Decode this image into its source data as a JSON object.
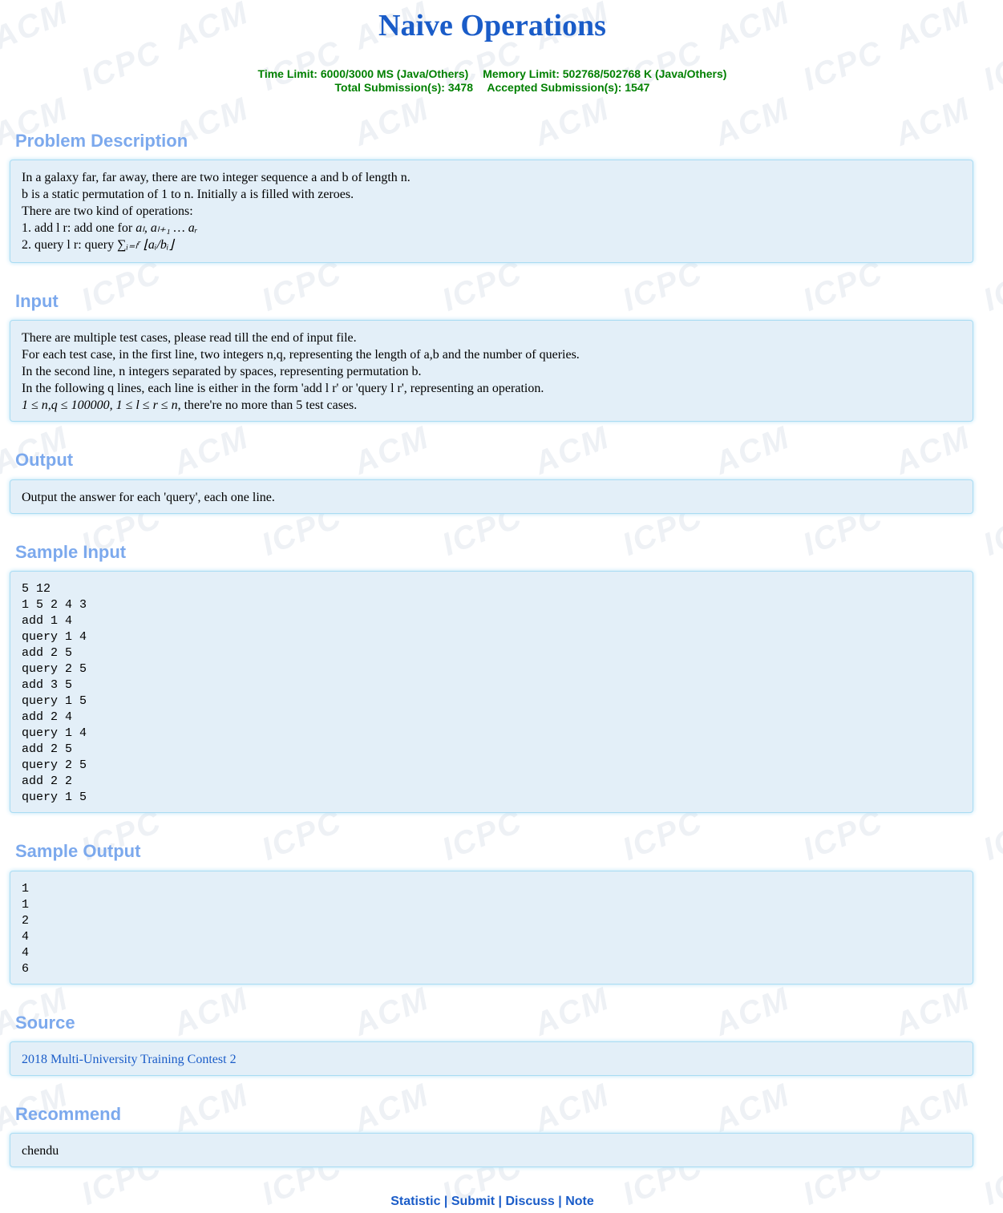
{
  "title": "Naive Operations",
  "limits": {
    "time": "Time Limit: 6000/3000 MS (Java/Others)",
    "memory": "Memory Limit: 502768/502768 K (Java/Others)",
    "total": "Total Submission(s): 3478",
    "accepted": "Accepted Submission(s): 1547"
  },
  "sections": {
    "description": {
      "heading": "Problem Description",
      "lines": [
        "In a galaxy far, far away, there are two integer sequence a and b of length n.",
        "b is a static permutation of 1 to n. Initially a is filled with zeroes.",
        "There are two kind of operations:"
      ],
      "op1_text": "1. add l r: add one for ",
      "op1_math": "aₗ, aₗ₊₁ … aᵣ",
      "op2_text": "2. query l r: query ",
      "op2_math": "∑ᵢ₌ₗʳ ⌊aᵢ/bᵢ⌋"
    },
    "input": {
      "heading": "Input",
      "lines": [
        "There are multiple test cases, please read till the end of input file.",
        "For each test case, in the first line, two integers n,q, representing the length of a,b and the number of queries.",
        "In the second line, n integers separated by spaces, representing permutation b.",
        "In the following q lines, each line is either in the form 'add l r' or 'query l r', representing an operation."
      ],
      "constraint_math": "1 ≤ n,q ≤ 100000, 1 ≤ l ≤ r ≤ n",
      "constraint_text": ", there're no more than 5 test cases."
    },
    "output": {
      "heading": "Output",
      "text": "Output the answer for each 'query', each one line."
    },
    "sample_input": {
      "heading": "Sample Input",
      "text": "5 12\n1 5 2 4 3\nadd 1 4\nquery 1 4\nadd 2 5\nquery 2 5\nadd 3 5\nquery 1 5\nadd 2 4\nquery 1 4\nadd 2 5\nquery 2 5\nadd 2 2\nquery 1 5"
    },
    "sample_output": {
      "heading": "Sample Output",
      "text": "1\n1\n2\n4\n4\n6"
    },
    "source": {
      "heading": "Source",
      "text": "2018 Multi-University Training Contest 2"
    },
    "recommend": {
      "heading": "Recommend",
      "text": "chendu"
    }
  },
  "footer": {
    "statistic": "Statistic",
    "submit": "Submit",
    "discuss": "Discuss",
    "note": "Note",
    "sep": " | "
  },
  "watermark": {
    "acm": "ACM",
    "icpc": "ICPC"
  },
  "colors": {
    "title": "#1a5cc8",
    "limits": "#008000",
    "heading": "#7ca9ed",
    "panel_bg": "#e3eff8",
    "panel_border": "#a9dcf3"
  }
}
